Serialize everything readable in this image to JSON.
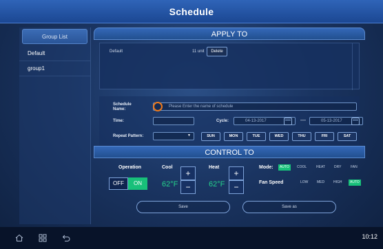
{
  "title": "Schedule",
  "sidebar": {
    "header": "Group List",
    "items": [
      {
        "label": "Default"
      },
      {
        "label": "group1"
      }
    ]
  },
  "apply_to": {
    "header": "APPLY TO",
    "rows": [
      {
        "name": "Default",
        "units": "11 unit",
        "delete_label": "Delete"
      }
    ]
  },
  "form": {
    "schedule_name_label": "Schedule Name:",
    "schedule_name_placeholder": "Please Enter the name of schedule",
    "time_label": "Time:",
    "cycle_label": "Cycle:",
    "cycle_start": "04-13-2017",
    "cycle_end": "05-13-2017",
    "repeat_label": "Repeat Pattern:",
    "days": [
      "SUN",
      "MON",
      "TUE",
      "WED",
      "THU",
      "FRI",
      "SAT"
    ]
  },
  "control_to": {
    "header": "CONTROL TO",
    "operation_label": "Operation",
    "off_label": "OFF",
    "on_label": "ON",
    "cool_label": "Cool",
    "cool_temp": "62°F",
    "heat_label": "Heat",
    "heat_temp": "62°F",
    "plus": "+",
    "minus": "−",
    "mode_label": "Mode:",
    "modes": [
      "AUTO",
      "COOL",
      "HEAT",
      "DRY",
      "FAN"
    ],
    "mode_active": "AUTO",
    "fan_label": "Fan Speed",
    "fan_speeds": [
      "LOW",
      "MED",
      "HIGH",
      "AUTO"
    ],
    "fan_active": "AUTO"
  },
  "actions": {
    "save": "Save",
    "save_as": "Save as"
  },
  "status": {
    "clock": "10:12"
  },
  "colors": {
    "accent": "#18c07a",
    "title_bar": "#2f64b8",
    "focus": "#ef7a1a"
  }
}
